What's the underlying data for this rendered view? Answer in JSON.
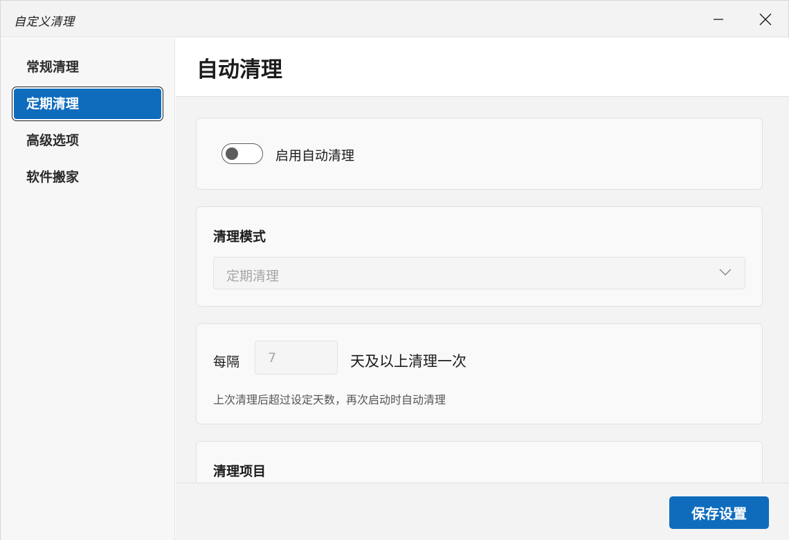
{
  "window": {
    "title": "自定义清理"
  },
  "sidebar": {
    "items": [
      {
        "label": "常规清理",
        "active": false
      },
      {
        "label": "定期清理",
        "active": true
      },
      {
        "label": "高级选项",
        "active": false
      },
      {
        "label": "软件搬家",
        "active": false
      }
    ]
  },
  "main": {
    "title": "自动清理",
    "enable": {
      "label": "启用自动清理",
      "on": false
    },
    "mode": {
      "title": "清理模式",
      "selected": "定期清理"
    },
    "interval": {
      "prefix": "每隔",
      "value": "7",
      "suffix": "天及以上清理一次",
      "hint": "上次清理后超过设定天数，再次启动时自动清理"
    },
    "items": {
      "title": "清理项目"
    }
  },
  "footer": {
    "save_label": "保存设置"
  },
  "colors": {
    "accent": "#0f6cbd"
  },
  "icons": {
    "minimize": "minimize-icon",
    "close": "close-icon",
    "dropdown": "chevron-down-icon"
  }
}
